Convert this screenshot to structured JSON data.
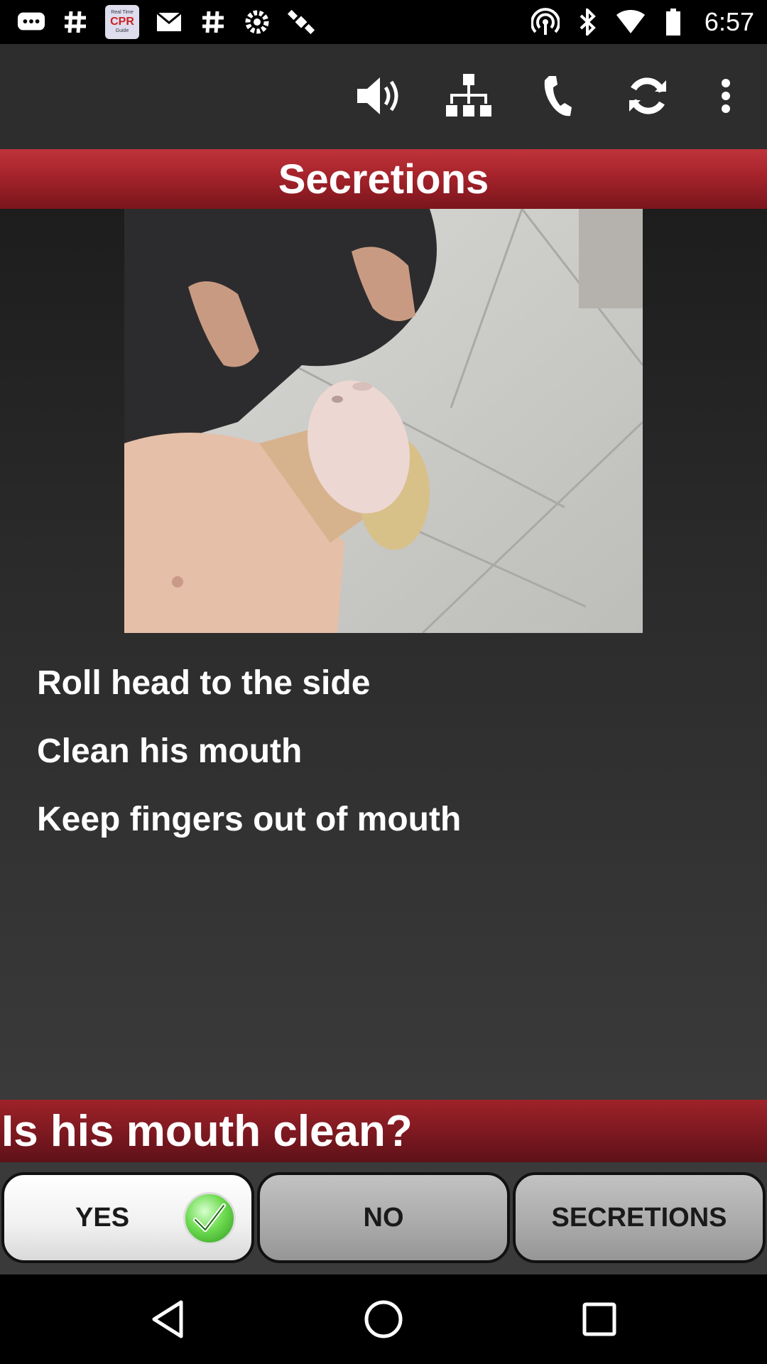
{
  "status_bar": {
    "time": "6:57",
    "app_logo_text": [
      "Real Time",
      "CPR",
      "Guide"
    ],
    "left_icons": [
      "message-icon",
      "hashtag-icon",
      "cpr-app-icon",
      "mail-icon",
      "hashtag-icon",
      "settings-gear-icon",
      "satellite-icon"
    ],
    "right_icons": [
      "hotspot-icon",
      "bluetooth-icon",
      "wifi-signal-icon",
      "battery-icon"
    ]
  },
  "action_bar": {
    "icons": [
      "volume-icon",
      "sitemap-icon",
      "phone-icon",
      "refresh-icon",
      "more-options-icon"
    ]
  },
  "title": "Secretions",
  "instructions": [
    "Roll head to the side",
    "Clean his mouth",
    "Keep fingers out of mouth"
  ],
  "question": "Is his mouth clean?",
  "buttons": {
    "yes": "YES",
    "no": "NO",
    "secretions": "SECRETIONS"
  },
  "nav": [
    "back-icon",
    "home-icon",
    "recents-icon"
  ],
  "colors": {
    "band_red": "#a5232b",
    "background": "#2d2d2d",
    "check_green": "#4fc22f"
  }
}
